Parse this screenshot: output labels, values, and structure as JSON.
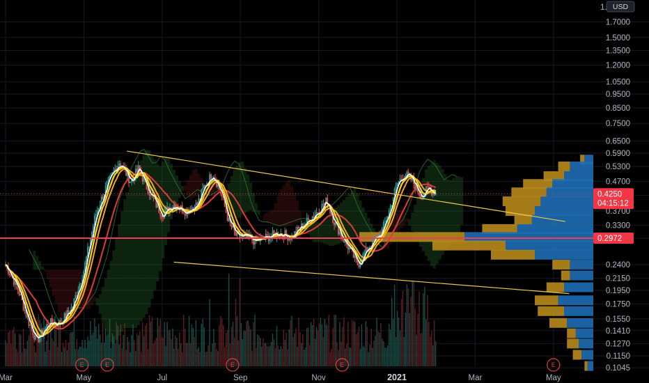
{
  "chart_data": {
    "type": "line",
    "scale": "log",
    "currency_label": "USD",
    "grid": true,
    "y_ticks": [
      1.7,
      1.5,
      1.35,
      1.2,
      1.05,
      0.95,
      0.85,
      0.75,
      0.65,
      0.59,
      0.53,
      0.47,
      0.42,
      0.37,
      0.33,
      0.297,
      0.24,
      0.215,
      0.195,
      0.175,
      0.155,
      0.141,
      0.127,
      0.115,
      0.1045
    ],
    "y_tick_labels": [
      "1.7000",
      "1.5000",
      "1.3500",
      "1.2000",
      "1.0500",
      "0.9500",
      "0.8500",
      "0.7500",
      "0.6500",
      "0.5900",
      "0.5300",
      "0.4700",
      "0.4250",
      "0.3700",
      "0.3300",
      "0.2972",
      "0.2400",
      "0.2150",
      "0.1950",
      "0.1750",
      "0.1550",
      "0.1410",
      "0.1270",
      "0.1150",
      "0.1045"
    ],
    "top_clipped_label": "1.",
    "x_labels": [
      "Mar",
      "May",
      "Jul",
      "Sep",
      "Nov",
      "2021",
      "Mar",
      "May"
    ],
    "x_label_months": [
      0,
      2,
      4,
      6,
      8,
      10,
      12,
      14
    ],
    "price_badge": {
      "value": 0.425,
      "label": "0.4250",
      "countdown": "04:15:12",
      "color": "#f23645"
    },
    "level_badge": {
      "value": 0.2972,
      "label": "0.2972",
      "color": "#f23645"
    },
    "events": [
      {
        "label": "E",
        "month": 1.95
      },
      {
        "label": "E",
        "month": 2.6
      },
      {
        "label": "E",
        "month": 5.8
      },
      {
        "label": "E",
        "month": 8.6
      },
      {
        "label": "E",
        "month": 14.0
      }
    ],
    "price": {
      "months": [
        0,
        0.3,
        0.6,
        0.8,
        1.1,
        1.4,
        1.7,
        2.0,
        2.3,
        2.6,
        2.9,
        3.2,
        3.4,
        3.6,
        3.8,
        4.0,
        4.3,
        4.6,
        4.9,
        5.1,
        5.3,
        5.5,
        5.7,
        5.9,
        6.1,
        6.4,
        6.7,
        7.0,
        7.3,
        7.6,
        7.9,
        8.2,
        8.4,
        8.6,
        8.8,
        9.0,
        9.3,
        9.6,
        9.8,
        10.0,
        10.2,
        10.4,
        10.6,
        10.8,
        11.0
      ],
      "close": [
        0.24,
        0.2,
        0.15,
        0.13,
        0.15,
        0.15,
        0.17,
        0.23,
        0.36,
        0.46,
        0.55,
        0.47,
        0.52,
        0.45,
        0.4,
        0.36,
        0.39,
        0.37,
        0.39,
        0.46,
        0.5,
        0.43,
        0.34,
        0.3,
        0.3,
        0.29,
        0.3,
        0.31,
        0.3,
        0.33,
        0.36,
        0.4,
        0.34,
        0.3,
        0.27,
        0.24,
        0.28,
        0.31,
        0.37,
        0.46,
        0.5,
        0.47,
        0.42,
        0.44,
        0.43
      ]
    },
    "channel_lines": [
      {
        "from": {
          "month": 3.1,
          "value": 0.6
        },
        "to": {
          "month": 14.3,
          "value": 0.34
        },
        "color": "#f2c94c"
      },
      {
        "from": {
          "month": 4.3,
          "value": 0.245
        },
        "to": {
          "month": 14.4,
          "value": 0.19
        },
        "color": "#f2c94c"
      }
    ],
    "volume_profile": [
      {
        "value": 0.56,
        "up": 0.015,
        "down": 0.03
      },
      {
        "value": 0.53,
        "up": 0.04,
        "down": 0.08
      },
      {
        "value": 0.49,
        "up": 0.07,
        "down": 0.1
      },
      {
        "value": 0.46,
        "up": 0.1,
        "down": 0.14
      },
      {
        "value": 0.43,
        "up": 0.12,
        "down": 0.16
      },
      {
        "value": 0.4,
        "up": 0.13,
        "down": 0.18
      },
      {
        "value": 0.37,
        "up": 0.1,
        "down": 0.2
      },
      {
        "value": 0.345,
        "up": 0.06,
        "down": 0.21
      },
      {
        "value": 0.32,
        "up": 0.12,
        "down": 0.26
      },
      {
        "value": 0.3,
        "up": 0.36,
        "down": 0.44
      },
      {
        "value": 0.28,
        "up": 0.25,
        "down": 0.3
      },
      {
        "value": 0.26,
        "up": 0.15,
        "down": 0.2
      },
      {
        "value": 0.24,
        "up": 0.06,
        "down": 0.08
      },
      {
        "value": 0.22,
        "up": 0.03,
        "down": 0.08
      },
      {
        "value": 0.2,
        "up": 0.06,
        "down": 0.1
      },
      {
        "value": 0.18,
        "up": 0.08,
        "down": 0.12
      },
      {
        "value": 0.165,
        "up": 0.09,
        "down": 0.1
      },
      {
        "value": 0.15,
        "up": 0.06,
        "down": 0.09
      },
      {
        "value": 0.138,
        "up": 0.03,
        "down": 0.06
      },
      {
        "value": 0.127,
        "up": 0.04,
        "down": 0.05
      },
      {
        "value": 0.116,
        "up": 0.03,
        "down": 0.04
      },
      {
        "value": 0.106,
        "up": 0.01,
        "down": 0.02
      }
    ],
    "colors": {
      "up_candle": "#26a69a",
      "down_candle": "#ef5350",
      "white_line": "#ffffff",
      "yellow_line": "#f5d10d",
      "orange_line": "#f5a623",
      "red_line": "#e03b3b",
      "cloud_green": "#2e7d32",
      "cloud_red": "#7b1f1f",
      "profile_up": "#b88a1c",
      "profile_down": "#1e6db4",
      "level_line": "#e83e5a"
    }
  }
}
